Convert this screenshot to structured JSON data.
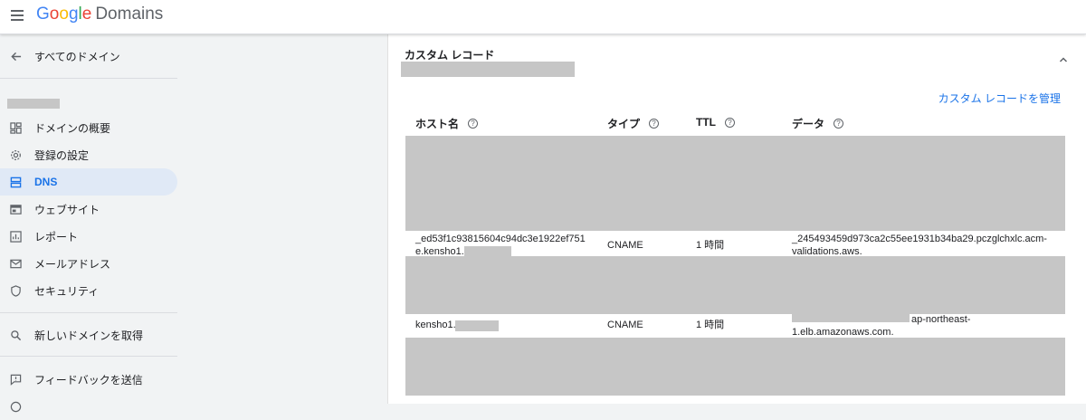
{
  "header": {
    "logo_google": "Google",
    "logo_product": "Domains"
  },
  "sidebar": {
    "back_label": "すべてのドメイン",
    "items": [
      {
        "label": "ドメインの概要",
        "icon": "dashboard-icon"
      },
      {
        "label": "登録の設定",
        "icon": "gear-icon"
      },
      {
        "label": "DNS",
        "icon": "dns-icon",
        "active": true
      },
      {
        "label": "ウェブサイト",
        "icon": "web-icon"
      },
      {
        "label": "レポート",
        "icon": "chart-icon"
      },
      {
        "label": "メールアドレス",
        "icon": "mail-icon"
      },
      {
        "label": "セキュリティ",
        "icon": "shield-icon"
      }
    ],
    "search_label": "新しいドメインを取得",
    "feedback_label": "フィードバックを送信"
  },
  "main": {
    "section_title": "カスタム レコード",
    "manage_link": "カスタム レコードを管理",
    "columns": [
      "ホスト名",
      "タイプ",
      "TTL",
      "データ"
    ],
    "help_glyph": "?",
    "rows": [
      {
        "host_line1": "_ed53f1c93815604c94dc3e1922ef751",
        "host_line2": "e.kensho1.",
        "type": "CNAME",
        "ttl": "1 時間",
        "data_line1": "_245493459d973ca2c55ee1931b34ba29.pczglchxlc.acm-",
        "data_line2": "validations.aws."
      },
      {
        "host_line1": "kensho1.",
        "type": "CNAME",
        "ttl": "1 時間",
        "data_line1": "ap-northeast-",
        "data_line2": "1.elb.amazonaws.com."
      }
    ]
  },
  "colors": {
    "accent": "#1a73e8",
    "active_bg": "#e0e9f6",
    "redaction": "#c6c6c6"
  }
}
